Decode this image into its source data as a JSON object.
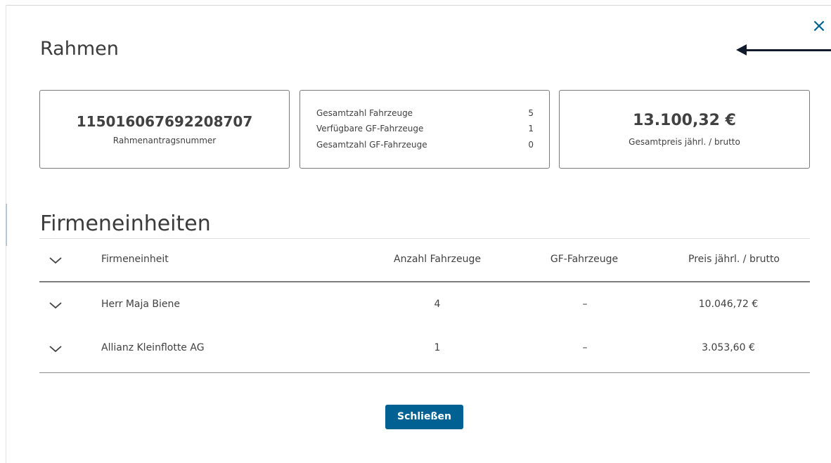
{
  "dialog": {
    "close_icon": "×",
    "title": "Rahmen",
    "accent_color": "#006192"
  },
  "cards": {
    "contract": {
      "number": "115016067692208707",
      "label": "Rahmenantragsnummer"
    },
    "stats": [
      {
        "label": "Gesamtzahl Fahrzeuge",
        "value": "5"
      },
      {
        "label": "Verfügbare GF-Fahrzeuge",
        "value": "1"
      },
      {
        "label": "Gesamtzahl GF-Fahrzeuge",
        "value": "0"
      }
    ],
    "price": {
      "amount": "13.100,32 €",
      "label": "Gesamtpreis jährl. / brutto"
    }
  },
  "units": {
    "title": "Firmeneinheiten",
    "columns": [
      "Firmeneinheit",
      "Anzahl Fahrzeuge",
      "GF-Fahrzeuge",
      "Preis jährl. / brutto"
    ],
    "rows": [
      {
        "name": "Herr Maja Biene",
        "vehicles": "4",
        "gf": "–",
        "price": "10.046,72 €"
      },
      {
        "name": "Allianz Kleinflotte AG",
        "vehicles": "1",
        "gf": "–",
        "price": "3.053,60 €"
      }
    ]
  },
  "footer": {
    "close_button": "Schließen"
  }
}
